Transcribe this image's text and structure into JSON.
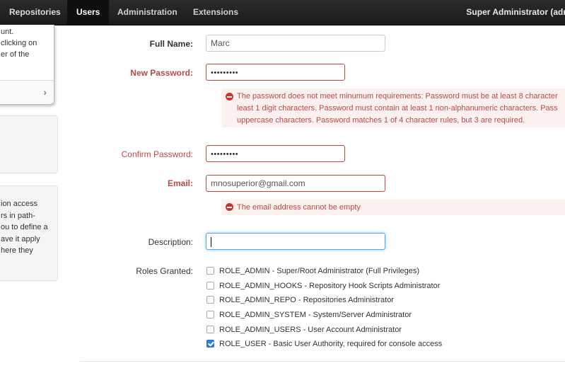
{
  "navbar": {
    "items": [
      {
        "label": "Repositories"
      },
      {
        "label": "Users"
      },
      {
        "label": "Administration"
      },
      {
        "label": "Extensions"
      }
    ],
    "user_label": "Super Administrator (adm"
  },
  "sidebar": {
    "panel1_lines": [
      "unt.",
      "clicking on",
      "er of the"
    ],
    "panel3_lines": [
      "ion access",
      "rs in path-",
      "ou to define a",
      "ave it apply",
      "here they"
    ]
  },
  "form": {
    "full_name": {
      "label": "Full Name:",
      "value": "Marc"
    },
    "new_password": {
      "label": "New Password:",
      "value": "•••••••••"
    },
    "password_error_lines": [
      "The password does not meet minumum requirements: Password must be at least 8 character",
      "least 1 digit characters. Password must contain at least 1 non-alphanumeric characters. Pass",
      "uppercase characters. Password matches 1 of 4 character rules, but 3 are required."
    ],
    "confirm_password": {
      "label": "Confirm Password:",
      "value": "•••••••••"
    },
    "email": {
      "label": "Email:",
      "value": "mnosuperior@gmail.com"
    },
    "email_error": "The email address cannot be empty",
    "description": {
      "label": "Description:",
      "value": ""
    },
    "roles_label": "Roles Granted:",
    "roles": [
      {
        "label": "ROLE_ADMIN - Super/Root Administrator (Full Privileges)",
        "checked": false
      },
      {
        "label": "ROLE_ADMIN_HOOKS - Repository Hook Scripts Administrator",
        "checked": false
      },
      {
        "label": "ROLE_ADMIN_REPO - Repositories Administrator",
        "checked": false
      },
      {
        "label": "ROLE_ADMIN_SYSTEM - System/Server Administrator",
        "checked": false
      },
      {
        "label": "ROLE_ADMIN_USERS - User Account Administrator",
        "checked": false
      },
      {
        "label": "ROLE_USER - Basic User Authority, required for console access",
        "checked": true
      }
    ]
  },
  "colors": {
    "error": "#b94a48",
    "navbar": "#1b1b1b",
    "accent": "#2f7ed8"
  }
}
